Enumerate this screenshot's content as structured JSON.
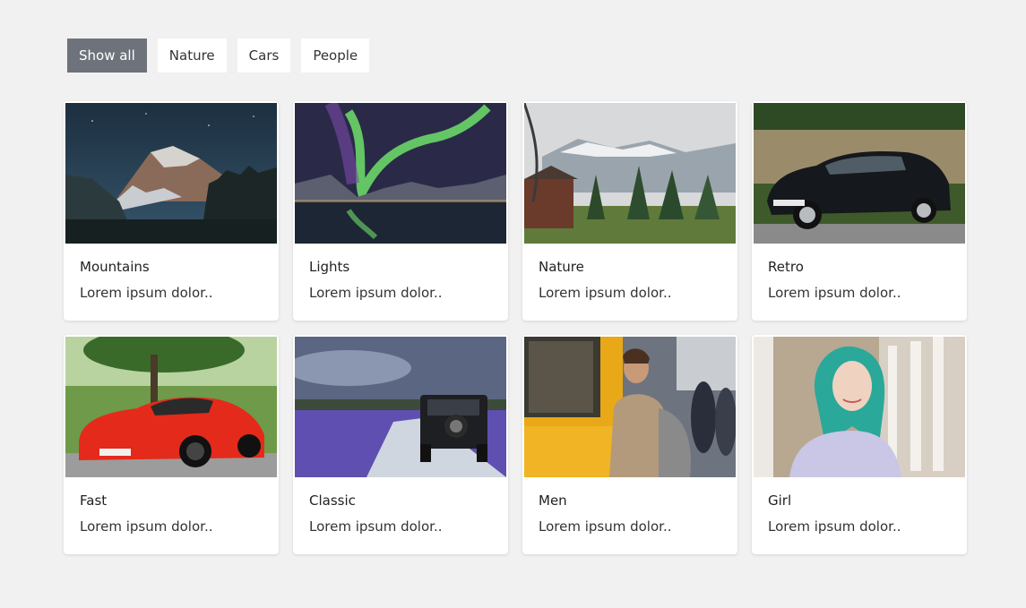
{
  "filters": [
    {
      "label": "Show all",
      "active": true
    },
    {
      "label": "Nature",
      "active": false
    },
    {
      "label": "Cars",
      "active": false
    },
    {
      "label": "People",
      "active": false
    }
  ],
  "cards": [
    {
      "title": "Mountains",
      "text": "Lorem ipsum dolor..",
      "image": "mountain-night-image"
    },
    {
      "title": "Lights",
      "text": "Lorem ipsum dolor..",
      "image": "aurora-lake-image"
    },
    {
      "title": "Nature",
      "text": "Lorem ipsum dolor..",
      "image": "alpine-valley-image"
    },
    {
      "title": "Retro",
      "text": "Lorem ipsum dolor..",
      "image": "black-hatchback-image"
    },
    {
      "title": "Fast",
      "text": "Lorem ipsum dolor..",
      "image": "red-sportscar-image"
    },
    {
      "title": "Classic",
      "text": "Lorem ipsum dolor..",
      "image": "offroad-jeep-image"
    },
    {
      "title": "Men",
      "text": "Lorem ipsum dolor..",
      "image": "man-train-station-image"
    },
    {
      "title": "Girl",
      "text": "Lorem ipsum dolor..",
      "image": "teal-hair-girl-image"
    }
  ]
}
